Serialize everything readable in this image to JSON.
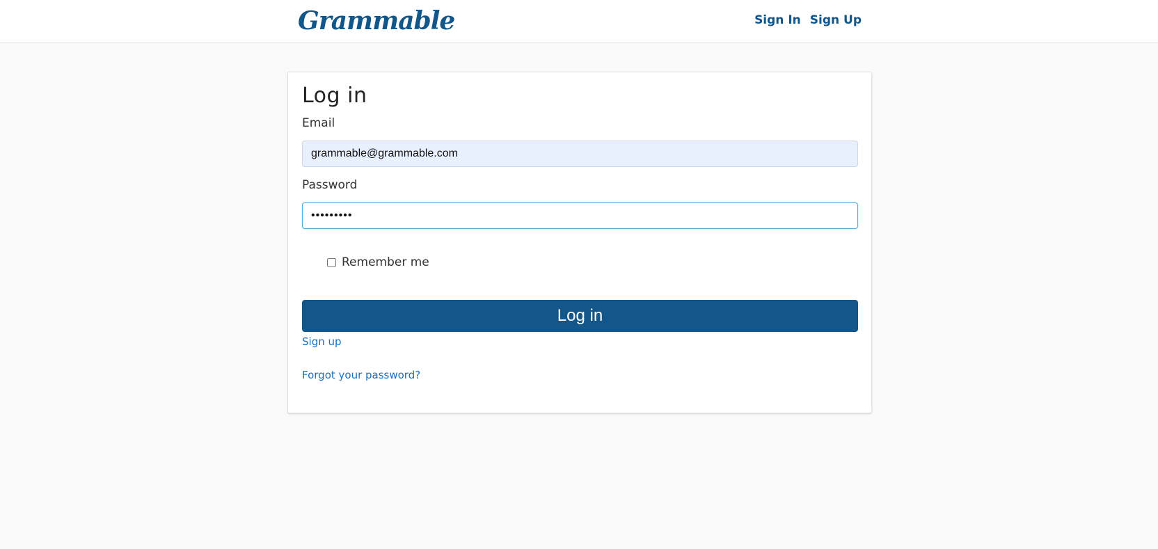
{
  "navbar": {
    "brand": "Grammable",
    "links": [
      {
        "label": "Sign In"
      },
      {
        "label": "Sign Up"
      }
    ]
  },
  "form": {
    "title": "Log in",
    "email": {
      "label": "Email",
      "value": "grammable@grammable.com"
    },
    "password": {
      "label": "Password",
      "value": "•••••••••"
    },
    "remember": {
      "label": "Remember me",
      "checked": false
    },
    "submit_label": "Log in",
    "links": {
      "sign_up": "Sign up",
      "forgot_password": "Forgot your password?"
    }
  },
  "colors": {
    "brand": "#11578a",
    "button": "#13578a",
    "link": "#1a6fbf",
    "autofill_bg": "#e8f0fe",
    "focus_border": "#57a7d8",
    "page_bg": "#f9f9f9"
  }
}
